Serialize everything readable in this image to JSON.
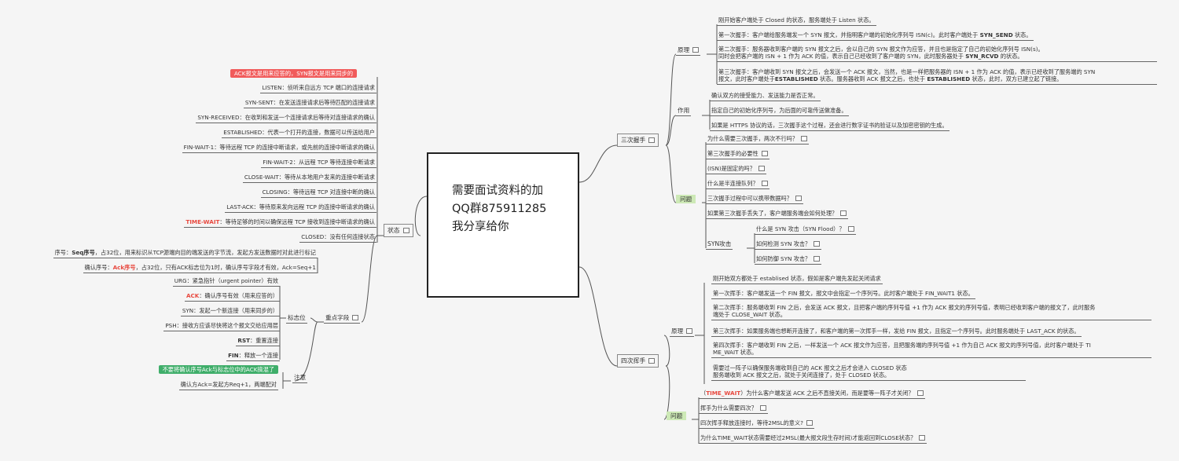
{
  "central": {
    "line1": "需要面试资料的加",
    "line2": "QQ群875911285",
    "line3": "我分享给你"
  },
  "states": {
    "label": "状态",
    "header_pill": "ACK报文是用来应答的，SYN报文是用来同步的",
    "items": [
      "LISTEN：侦听来自远方 TCP 端口的连接请求",
      "SYN-SENT：在发送连接请求后等待匹配的连接请求",
      "SYN-RECEIVED：在收到和发送一个连接请求后等待对连接请求的确认",
      "ESTABLISHED：代表一个打开的连接，数据可以传送给用户",
      "FIN-WAIT-1：等待远程 TCP 的连接中断请求，或先前的连接中断请求的确认",
      "FIN-WAIT-2：从远程 TCP 等待连接中断请求",
      "CLOSE-WAIT：等待从本地用户发来的连接中断请求",
      "CLOSING：等待远程 TCP 对连接中断的确认",
      "LAST-ACK：等待原来发向远程 TCP 的连接中断请求的确认"
    ],
    "time_wait_key": "TIME-WAIT",
    "time_wait_desc": "：等待足够的时间以确保远程 TCP 接收到连接中断请求的确认",
    "closed": "CLOSED：没有任何连接状态"
  },
  "fields": {
    "label": "重点字段",
    "seq_prefix": "序号：",
    "seq_key": "Seq序号",
    "seq_desc": "，占32位，用来标识从TCP源端向目的端发送的字节流，发起方发送数据时对此进行标记",
    "ack_prefix": "确认序号：",
    "ack_key": "Ack序号",
    "ack_desc": "，占32位，只有ACK标志位为1时，确认序号字段才有效，Ack=Seq+1",
    "flags_label": "标志位",
    "flags": {
      "urg": "URG：紧急指针（urgent pointer）有效",
      "ack_key": "ACK",
      "ack_desc": "：确认序号有效（用来应答的）",
      "syn": "SYN：发起一个新连接（用来同步的）",
      "psh": "PSH：接收方应该尽快将这个报文交给应用层",
      "rst_key": "RST",
      "rst_desc": "：重置连接",
      "fin_key": "FIN",
      "fin_desc": "：释放一个连接"
    },
    "note_label": "注意",
    "note_pill": "不要将确认序号Ack与标志位中的ACK搞混了",
    "note_text": "确认方Ack=发起方Req+1，两端配对"
  },
  "handshake": {
    "label": "三次握手",
    "principle_label": "原理",
    "principle": {
      "p0": "刚开始客户端处于 Closed 的状态，服务端处于 Listen 状态。",
      "p1": "第一次握手：客户端给服务端发一个 SYN 报文，并指明客户端的初始化序列号 ISN(c)。此时客户端处于",
      "p1_bold": "SYN_SEND",
      "p1_tail": "状态。",
      "p2a": "第二次握手：服务器收到客户端的 SYN 报文之后，会以自己的 SYN 报文作为应答，并且也是指定了自己的初始化序列号 ISN(s)。",
      "p2b": "同时会把客户端的 ISN + 1 作为 ACK 的值，表示自己已经收到了客户端的 SYN，此时服务器处于",
      "p2b_bold": "SYN_RCVD",
      "p2b_tail": "的状态。",
      "p3a": "第三次握手：客户端收到 SYN 报文之后，会发送一个 ACK 报文，当然，也是一样把服务器的 ISN + 1 作为 ACK 的值，表示已经收到了服务端的 SYN",
      "p3b": "报文，此时客户端处于",
      "p3b_bold1": "ESTABLISHED",
      "p3b_mid": "状态。服务器收到 ACK 报文之后，也处于",
      "p3b_bold2": "ESTABLISHED",
      "p3b_tail": "状态，此时，双方已建立起了链接。"
    },
    "purpose_label": "作用",
    "purpose": [
      "确认双方的接受能力、发送能力是否正常。",
      "指定自己的初始化序列号，为后面的可靠传送做准备。",
      "如果是 HTTPS 协议的话，三次握手这个过程，还会进行数字证书的验证以及加密密钥的生成。"
    ],
    "questions_label": "问题",
    "questions": [
      "为什么需要三次握手，两次不行吗？",
      "第三次握手的必要性",
      "(ISN)是固定的吗？",
      "什么是半连接队列？",
      "三次握手过程中可以携带数据吗？",
      "如果第三次握手丢失了，客户端服务端会如何处理？"
    ],
    "syn_attack_label": "SYN攻击",
    "syn_attack": [
      "什么是 SYN 攻击（SYN Flood）？",
      "如何检测 SYN 攻击？",
      "如何防御 SYN 攻击？"
    ]
  },
  "wave": {
    "label": "四次挥手",
    "principle_label": "原理",
    "principle": {
      "p0": "刚开始双方都处于 establised 状态，假如是客户端先发起关闭请求",
      "p1": "第一次挥手：客户端发送一个 FIN 报文，报文中会指定一个序列号。此时客户端处于 FIN_WAIT1 状态。",
      "p2a": "第二次挥手：服务端收到 FIN 之后，会发送 ACK 报文，且把客户端的序列号值 +1 作为 ACK 报文的序列号值，表明已经收到客户端的报文了，此时服务",
      "p2b": "端处于 CLOSE_WAIT 状态。",
      "p3": "第三次挥手：如果服务端也想断开连接了，和客户端的第一次挥手一样，发给 FIN 报文，且指定一个序列号。此时服务端处于 LAST_ACK 的状态。",
      "p4a": "第四次挥手：客户端收到 FIN 之后，一样发送一个 ACK 报文作为应答，且把服务端的序列号值 +1 作为自己 ACK 报文的序列号值，此时客户端处于 TI",
      "p4b": "ME_WAIT 状态。",
      "p5a": "需要过一阵子以确保服务端收到自己的 ACK 报文之后才会进入 CLOSED 状态",
      "p5b": "服务端收到 ACK 报文之后，就处于关闭连接了，处于 CLOSED 状态。"
    },
    "questions_label": "问题",
    "q1_open": "（",
    "q1_key": "TIME_WAIT",
    "q1_text": "）为什么客户端发送 ACK 之后不直接关闭，而是要等一阵子才关闭？",
    "questions": [
      "挥手为什么需要四次？",
      "四次挥手释放连接时，等待2MSL的意义?",
      "为什么TIME_WAIT状态需要经过2MSL(最大报文段生存时间)才能返回到CLOSE状态？"
    ]
  }
}
